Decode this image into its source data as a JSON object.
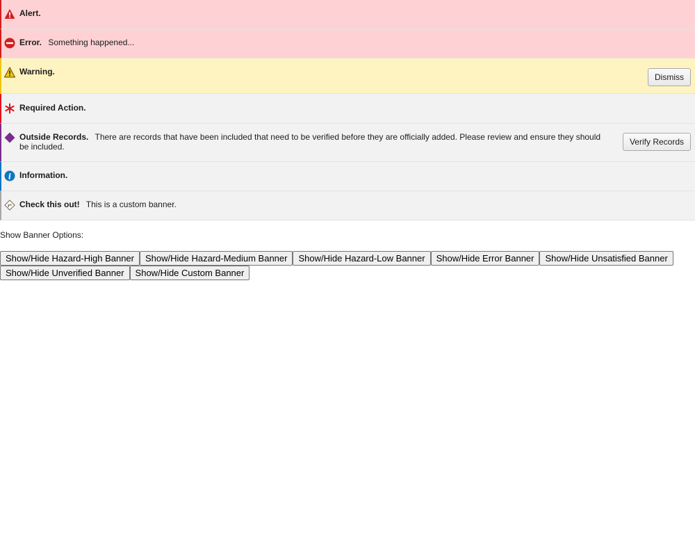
{
  "banners": {
    "alert": {
      "icon": "hazard-high-icon",
      "title": "Alert.",
      "message": ""
    },
    "error": {
      "icon": "error-icon",
      "title": "Error.",
      "message": "Something happened..."
    },
    "warning": {
      "icon": "warning-icon",
      "title": "Warning.",
      "message": "",
      "action_label": "Dismiss"
    },
    "required": {
      "icon": "asterisk-icon",
      "title": "Required Action.",
      "message": ""
    },
    "outside": {
      "icon": "diamond-icon",
      "title": "Outside Records.",
      "message": "There are records that have been included that need to be verified before they are officially added. Please review and ensure they should be included.",
      "action_label": "Verify Records"
    },
    "info": {
      "icon": "info-icon",
      "title": "Information.",
      "message": ""
    },
    "custom": {
      "icon": "custom-diamond-arrow-icon",
      "title": "Check this out!",
      "message": "This is a custom banner."
    }
  },
  "options": {
    "label": "Show Banner Options:",
    "buttons": [
      "Show/Hide Hazard-High Banner",
      "Show/Hide Hazard-Medium Banner",
      "Show/Hide Hazard-Low Banner",
      "Show/Hide Error Banner",
      "Show/Hide Unsatisfied Banner",
      "Show/Hide Unverified Banner",
      "Show/Hide Custom Banner"
    ]
  },
  "colors": {
    "hazard_high": "#d11f1f",
    "hazard_high_bg": "#fed2d5",
    "warning": "#f1c40f",
    "warning_bg": "#fef4c2",
    "required": "#e0141e",
    "unverified": "#7a2b8f",
    "info": "#0d76c2",
    "neutral_bg": "#f2f2f2"
  }
}
